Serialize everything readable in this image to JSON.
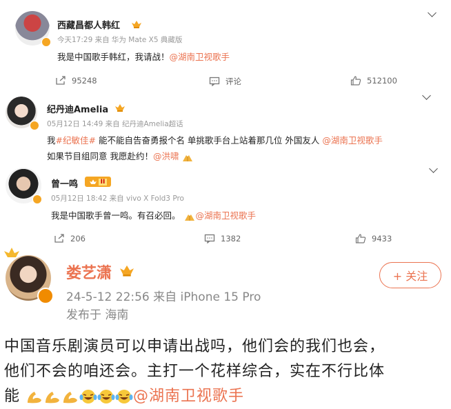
{
  "posts": [
    {
      "author": "西藏昌都人韩红",
      "meta": "今天17:29 来自 华为 Mate X5 典藏版",
      "text": "我是中国歌手韩红，我请战！",
      "mention": "@湖南卫视歌手",
      "repost_count": "95248",
      "comment_label": "评论",
      "like_count": "512100"
    },
    {
      "author": "纪丹迪Amelia",
      "meta": "05月12日 14:49 来自 纪丹迪Amelia超话",
      "line1_prefix": "我",
      "hashtag": "#纪敏佳#",
      "line1_text": " 能不能自告奋勇报个名 单挑歌手台上站着那几位 外国友人 ",
      "line1_mention": "@湖南卫视歌手",
      "line2_text": "如果节目组同意 我愿赴约！",
      "line2_mention": "@洪啸"
    },
    {
      "author": "曾一鸣",
      "badge": "II",
      "meta": "05月12日 18:42 来自 vivo X Fold3 Pro",
      "text": "我是中国歌手曾一鸣。有召必回。",
      "mention": "@湖南卫视歌手",
      "repost_count": "206",
      "comment_count": "1382",
      "like_count": "9433"
    },
    {
      "author": "娄艺潇",
      "meta": "24-5-12 22:56  来自 iPhone 15 Pro",
      "location": "发布于 海南",
      "follow_label": "+ 关注",
      "line1": "中国音乐剧演员可以申请出战吗，他们会的我们也会，",
      "line2": "他们不会的咱还会。主打一个花样综合，实在不行比体",
      "line3_prefix": "能",
      "mention": "@湖南卫视歌手"
    }
  ],
  "colors": {
    "accent": "#eb7350",
    "gold": "#f5a623",
    "meta": "#999999"
  },
  "icons": [
    "repost-icon",
    "comment-icon",
    "like-icon",
    "chevron-down-icon",
    "crown-icon",
    "verified-badge-icon",
    "praying-hands-emoji",
    "flexed-biceps-emoji",
    "laughing-tears-emoji"
  ]
}
